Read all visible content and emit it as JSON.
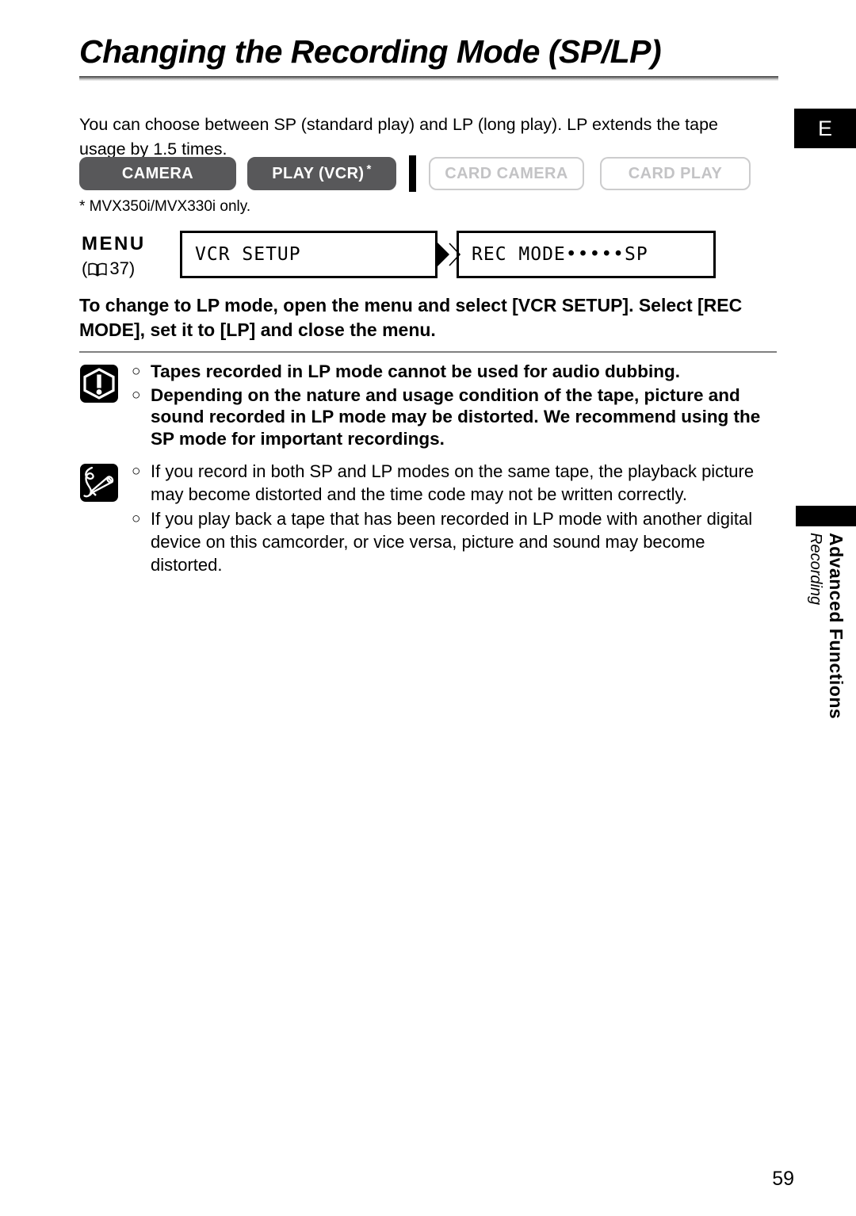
{
  "page": {
    "title": "Changing the Recording Mode (SP/LP)",
    "language_tab": "E",
    "number": "59"
  },
  "intro": {
    "text": "You can choose between SP (standard play) and LP (long play). LP extends the tape usage by 1.5 times."
  },
  "modes": {
    "buttons": [
      {
        "label": "CAMERA",
        "state": "active",
        "footnote_marker": ""
      },
      {
        "label": "PLAY (VCR)",
        "state": "active",
        "footnote_marker": "*"
      },
      {
        "label": "CARD CAMERA",
        "state": "disabled",
        "footnote_marker": ""
      },
      {
        "label": "CARD PLAY",
        "state": "disabled",
        "footnote_marker": ""
      }
    ],
    "footnote": "* MVX350i/MVX330i only."
  },
  "menu_flow": {
    "label": "MENU",
    "reference_open": "(",
    "reference_page": "37",
    "reference_close": ")",
    "book_icon": "book-icon",
    "arrow_icon": "play-arrow-icon",
    "step_1": "VCR SETUP",
    "step_2": "REC MODE•••••SP"
  },
  "instruction": {
    "text": "To change to LP mode, open the menu and select [VCR SETUP]. Select [REC MODE], set it to [LP] and close the menu."
  },
  "notes": {
    "warning": {
      "icon": "warning-exclamation-icon",
      "bullet": "○",
      "items": [
        "Tapes recorded in LP mode cannot be used for audio dubbing.",
        "Depending on the nature and usage condition of the tape, picture and sound recorded in LP mode may be distorted. We recommend using the SP mode for important recordings."
      ]
    },
    "info": {
      "icon": "memo-pencil-icon",
      "bullet": "○",
      "items": [
        "If you record in both SP and LP modes on the same tape, the playback picture may become distorted and the time code may not be written correctly.",
        "If you play back a tape that has been recorded in LP mode with another digital device on this camcorder, or vice versa, picture and sound may become distorted."
      ]
    }
  },
  "section_tab": {
    "title": "Advanced Functions",
    "subtitle": "Recording"
  },
  "colors": {
    "active_button": "#58585a",
    "disabled_border": "#cccccd",
    "disabled_text": "#c3c3c5",
    "rule": "#808080",
    "tab_black": "#000000"
  }
}
